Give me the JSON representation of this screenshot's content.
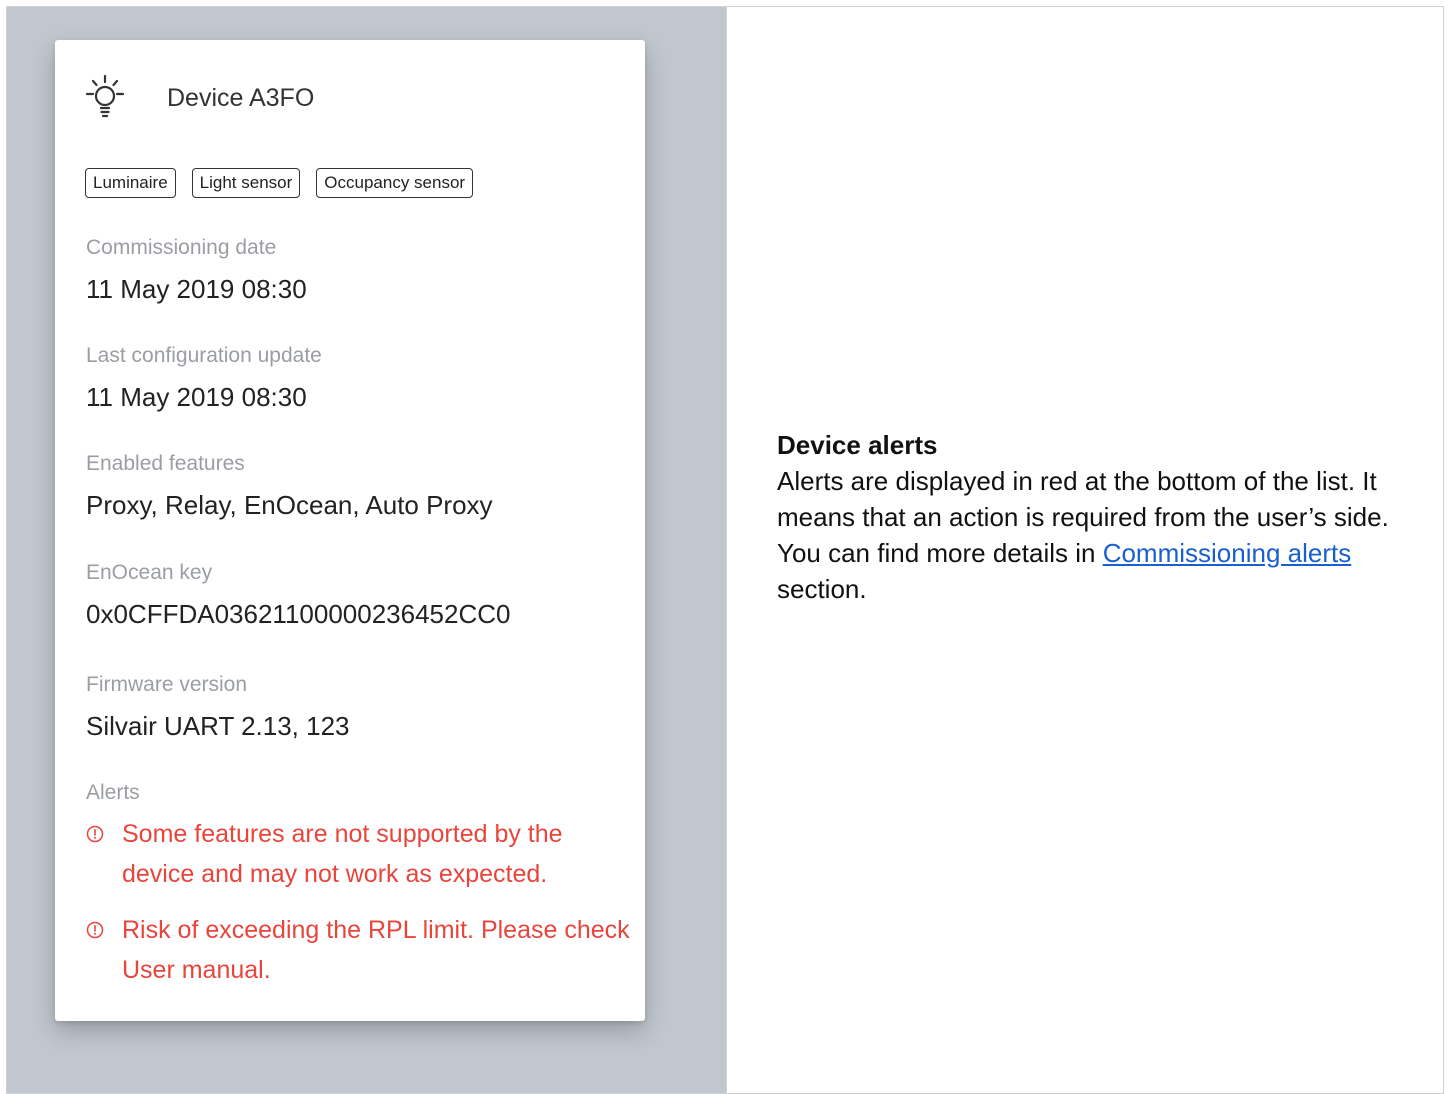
{
  "device": {
    "icon": "lightbulb-icon",
    "name": "Device A3FO",
    "tags": [
      "Luminaire",
      "Light sensor",
      "Occupancy sensor"
    ],
    "fields": [
      {
        "label": "Commissioning date",
        "value": "11 May 2019   08:30"
      },
      {
        "label": "Last configuration update",
        "value": "11 May 2019   08:30"
      },
      {
        "label": "Enabled features",
        "value": "Proxy, Relay, EnOcean, Auto Proxy"
      },
      {
        "label": "EnOcean key",
        "value": "0x0CFFDA03621100000236452CC0"
      },
      {
        "label": "Firmware version",
        "value": "Silvair UART 2.13, 123"
      }
    ],
    "alerts_label": "Alerts",
    "alerts": [
      {
        "icon": "alert-circle-icon",
        "text": "Some features are not supported by the device and may not work as expected."
      },
      {
        "icon": "alert-circle-icon",
        "text": "Risk of exceeding the RPL limit. Please check User manual."
      }
    ]
  },
  "note": {
    "title": "Device alerts",
    "body": "Alerts are displayed in red at the bottom of the list. It means that an action is required from the user’s side. You can find more details in ",
    "link_text": "Commissioning alerts ",
    "suffix": "section."
  },
  "colors": {
    "background": "#c1c7cf",
    "alert": "#e8453c",
    "link": "#1a5fd0",
    "label": "#9a9ea3"
  }
}
